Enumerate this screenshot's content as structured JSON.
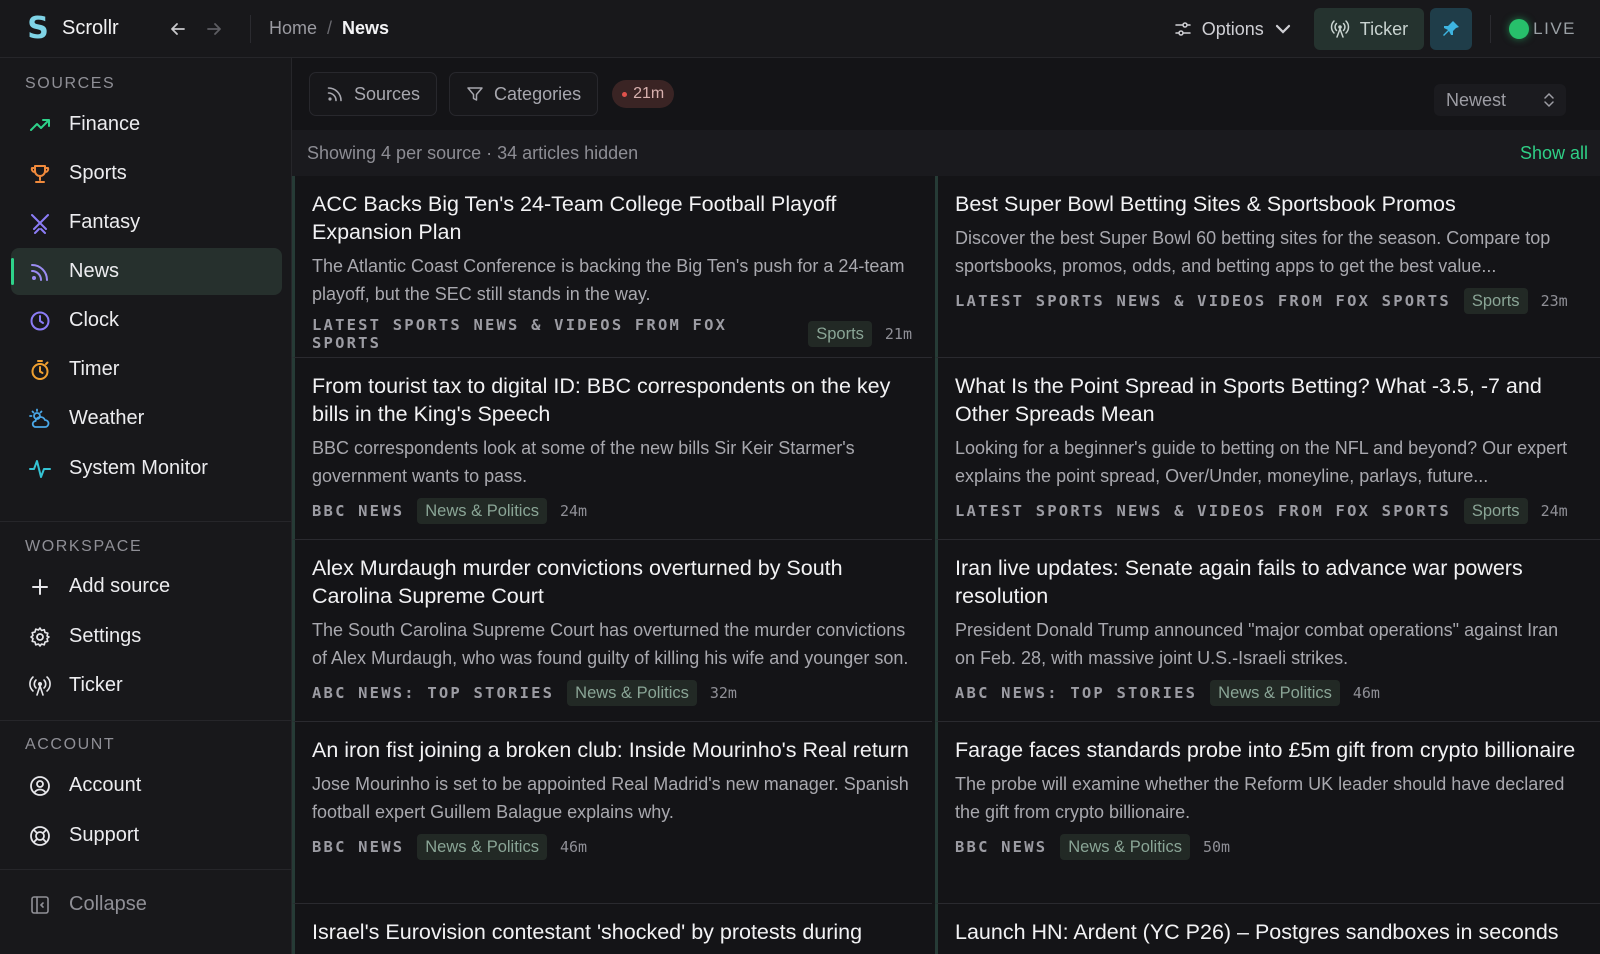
{
  "app": {
    "name": "Scrollr",
    "logo_letter": "S"
  },
  "breadcrumb": {
    "home": "Home",
    "separator": "/",
    "current": "News"
  },
  "topbar": {
    "options_label": "Options",
    "ticker_label": "Ticker",
    "live_label": "LIVE"
  },
  "sidebar": {
    "sources_title": "SOURCES",
    "sources": [
      {
        "label": "Finance",
        "icon": "trending-up-icon",
        "color": "#2ed28a"
      },
      {
        "label": "Sports",
        "icon": "trophy-icon",
        "color": "#f08a3c"
      },
      {
        "label": "Fantasy",
        "icon": "crossed-swords-icon",
        "color": "#8b7cf6"
      },
      {
        "label": "News",
        "icon": "rss-icon",
        "color": "#9b8cf2"
      },
      {
        "label": "Clock",
        "icon": "clock-icon",
        "color": "#8b7cf6"
      },
      {
        "label": "Timer",
        "icon": "timer-icon",
        "color": "#f0a030"
      },
      {
        "label": "Weather",
        "icon": "cloud-sun-icon",
        "color": "#4aa8e8"
      },
      {
        "label": "System Monitor",
        "icon": "activity-icon",
        "color": "#35c4d4"
      }
    ],
    "workspace_title": "WORKSPACE",
    "workspace": [
      {
        "label": "Add source",
        "icon": "plus-icon"
      },
      {
        "label": "Settings",
        "icon": "gear-icon"
      },
      {
        "label": "Ticker",
        "icon": "broadcast-icon"
      }
    ],
    "account_title": "ACCOUNT",
    "account": [
      {
        "label": "Account",
        "icon": "user-circle-icon"
      },
      {
        "label": "Support",
        "icon": "lifebuoy-icon"
      }
    ],
    "collapse_label": "Collapse"
  },
  "filters": {
    "sources_label": "Sources",
    "categories_label": "Categories",
    "time_badge": "21m",
    "sort_value": "Newest"
  },
  "info": {
    "text": "Showing 4 per source · 34 articles hidden",
    "show_all": "Show all"
  },
  "articles": [
    {
      "title": "ACC Backs Big Ten's 24-Team College Football Playoff Expansion Plan",
      "desc": "The Atlantic Coast Conference is backing the Big Ten's push for a 24-team playoff, but the SEC still stands in the way.",
      "source": "LATEST SPORTS NEWS & VIDEOS FROM FOX SPORTS",
      "tag": "Sports",
      "age": "21m"
    },
    {
      "title": "Best Super Bowl Betting Sites & Sportsbook Promos",
      "desc": "Discover the best Super Bowl 60 betting sites for the season. Compare top sportsbooks, promos, odds, and betting apps to get the best value...",
      "source": "LATEST SPORTS NEWS & VIDEOS FROM FOX SPORTS",
      "tag": "Sports",
      "age": "23m"
    },
    {
      "title": "From tourist tax to digital ID: BBC correspondents on the key bills in the King's Speech",
      "desc": "BBC correspondents look at some of the new bills Sir Keir Starmer's government wants to pass.",
      "source": "BBC NEWS",
      "tag": "News & Politics",
      "age": "24m"
    },
    {
      "title": "What Is the Point Spread in Sports Betting? What -3.5, -7 and Other Spreads Mean",
      "desc": "Looking for a beginner's guide to betting on the NFL and beyond? Our expert explains the point spread, Over/Under, moneyline, parlays, future...",
      "source": "LATEST SPORTS NEWS & VIDEOS FROM FOX SPORTS",
      "tag": "Sports",
      "age": "24m"
    },
    {
      "title": "Alex Murdaugh murder convictions overturned by South Carolina Supreme Court",
      "desc": "The South Carolina Supreme Court has overturned the murder convictions of Alex Murdaugh, who was found guilty of killing his wife and younger son.",
      "source": "ABC NEWS: TOP STORIES",
      "tag": "News & Politics",
      "age": "32m"
    },
    {
      "title": "Iran live updates: Senate again fails to advance war powers resolution",
      "desc": "President Donald Trump announced \"major combat operations\" against Iran on Feb. 28, with massive joint U.S.-Israeli strikes.",
      "source": "ABC NEWS: TOP STORIES",
      "tag": "News & Politics",
      "age": "46m"
    },
    {
      "title": "An iron fist joining a broken club: Inside Mourinho's Real return",
      "desc": "Jose Mourinho is set to be appointed Real Madrid's new manager. Spanish football expert Guillem Balague explains why.",
      "source": "BBC NEWS",
      "tag": "News & Politics",
      "age": "46m"
    },
    {
      "title": "Farage faces standards probe into £5m gift from crypto billionaire",
      "desc": "The probe will examine whether the Reform UK leader should have declared the gift from crypto billionaire.",
      "source": "BBC NEWS",
      "tag": "News & Politics",
      "age": "50m"
    },
    {
      "title": "Israel's Eurovision contestant 'shocked' by protests during",
      "desc": "",
      "source": "",
      "tag": "",
      "age": ""
    },
    {
      "title": "Launch HN: Ardent (YC P26) – Postgres sandboxes in seconds",
      "desc": "",
      "source": "",
      "tag": "",
      "age": ""
    }
  ]
}
